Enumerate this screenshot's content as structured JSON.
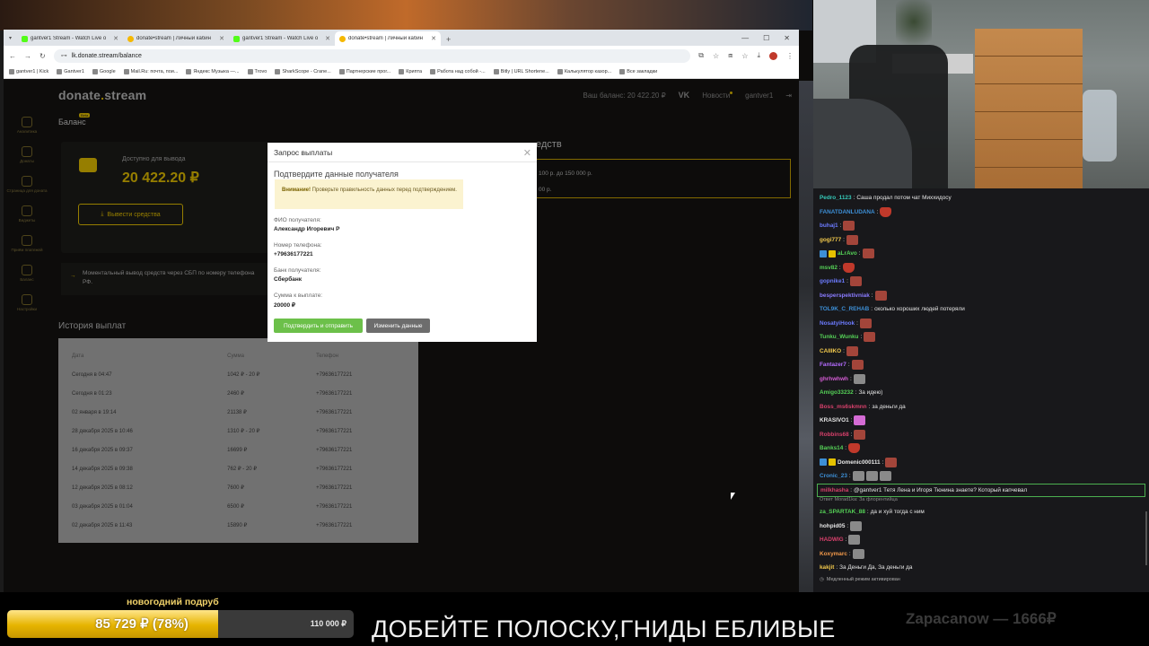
{
  "browser": {
    "tabs": [
      {
        "icon": "kick",
        "label": "gantver1 Stream - Watch Live o",
        "active": false
      },
      {
        "icon": "donate",
        "label": "donate•stream | Личный кабин",
        "active": false
      },
      {
        "icon": "kick",
        "label": "gantver1 Stream - Watch Live o",
        "active": false
      },
      {
        "icon": "donate",
        "label": "donate•stream | Личный кабин",
        "active": true
      }
    ],
    "new_tab": "+",
    "url": "lk.donate.stream/balance",
    "bookmarks": [
      "gantver1 | Kick",
      "Gantver1",
      "Google",
      "Mail.Ru: почта, пои...",
      "Яндекс Музыка —...",
      "Trovo",
      "SharkScope - Crane...",
      "Партнерские прог...",
      "Крипта",
      "Работа над собой -...",
      "Bitly | URL Shortene...",
      "Калькулятор казор...",
      "Все закладки"
    ]
  },
  "site": {
    "logo_main": "donate",
    "logo_dot": ".",
    "logo_end": "stream",
    "balance_header": "Ваш баланс: 20 422.20 ₽",
    "vk": "VK",
    "news": "Новости",
    "user": "gantver1",
    "sidebar": [
      {
        "icon": "analytics-icon",
        "label": "Аналитика"
      },
      {
        "icon": "donations-icon",
        "label": "Донаты"
      },
      {
        "icon": "page-icon",
        "label": "Страница для доната"
      },
      {
        "icon": "widgets-icon",
        "label": "Виджеты"
      },
      {
        "icon": "payments-icon",
        "label": "Приём платежей"
      },
      {
        "icon": "balance-icon",
        "label": "Баланс"
      },
      {
        "icon": "settings-icon",
        "label": "Настройки"
      }
    ],
    "page_title": "Баланс",
    "beta_badge": "Beta",
    "available_label": "Доступно для вывода",
    "available_value": "20 422.20 ₽",
    "withdraw_button": "Вывести средства",
    "sbp_note": "Моментальный вывод средств через СБП по номеру телефона РФ.",
    "conditions_title": "едств",
    "conditions_lines": [
      "100 р. до 150 000 р.",
      "00 р."
    ],
    "history_title": "История выплат",
    "history_columns": [
      "Дата",
      "Сумма",
      "Телефон"
    ],
    "history_rows": [
      [
        "Сегодня в 04:47",
        "1042 ₽ - 20 ₽",
        "+79636177221"
      ],
      [
        "Сегодня в 01:23",
        "2460 ₽",
        "+79636177221"
      ],
      [
        "02 января в 19:14",
        "21138 ₽",
        "+79636177221"
      ],
      [
        "28 декабря 2025 в 10:46",
        "1310 ₽ - 20 ₽",
        "+79636177221"
      ],
      [
        "16 декабря 2025 в 09:37",
        "16699 ₽",
        "+79636177221"
      ],
      [
        "14 декабря 2025 в 09:38",
        "762 ₽ - 20 ₽",
        "+79636177221"
      ],
      [
        "12 декабря 2025 в 08:12",
        "7600 ₽",
        "+79636177221"
      ],
      [
        "03 декабря 2025 в 01:04",
        "6500 ₽",
        "+79636177221"
      ],
      [
        "02 декабря 2025 в 11:43",
        "15890 ₽",
        "+79636177221"
      ]
    ]
  },
  "modal": {
    "title": "Запрос выплаты",
    "subtitle": "Подтвердите данные получателя",
    "warning_bold": "Внимание!",
    "warning_text": " Проверьте правильность данных перед подтверждением.",
    "fields": [
      {
        "label": "ФИО получателя:",
        "value": "Александр Игоревич Р"
      },
      {
        "label": "Номер телефона:",
        "value": "+79636177221"
      },
      {
        "label": "Банк получателя:",
        "value": "Сбербанк"
      },
      {
        "label": "Сумма к выплате:",
        "value": "20000 ₽"
      }
    ],
    "confirm_button": "Подтвердить и отправить",
    "edit_button": "Изменить данные"
  },
  "chat": {
    "messages": [
      {
        "user": "Pedro_1123",
        "color": "#35c9b8",
        "text": "Саша продал потом чат Миххидосу",
        "emotes": 0
      },
      {
        "user": "FANATDANLUDANA",
        "color": "#3d8fd6",
        "text": "",
        "emotes": 1,
        "emote_style": "red"
      },
      {
        "user": "buhaj1",
        "color": "#6c7bff",
        "text": "",
        "emotes": 1
      },
      {
        "user": "gogi777",
        "color": "#f2c94c",
        "text": "",
        "emotes": 1
      },
      {
        "user": "aLrAvo",
        "color": "#55d157",
        "text": "",
        "emotes": 1,
        "badges": 2
      },
      {
        "user": "msv82",
        "color": "#55d157",
        "text": "",
        "emotes": 1,
        "emote_style": "red"
      },
      {
        "user": "gopnike1",
        "color": "#6c7bff",
        "text": "",
        "emotes": 1
      },
      {
        "user": "besperspektivniak",
        "color": "#8a7bff",
        "text": "",
        "emotes": 1
      },
      {
        "user": "TOL9K_C_REHAB",
        "color": "#3d8fd6",
        "text": "сколько хороших людей потеряли",
        "emotes": 0
      },
      {
        "user": "NosatyiHook",
        "color": "#6c7bff",
        "text": "",
        "emotes": 1
      },
      {
        "user": "Tunku_Wunku",
        "color": "#55d157",
        "text": "",
        "emotes": 1
      },
      {
        "user": "CAIIIKO",
        "color": "#f2c94c",
        "text": "",
        "emotes": 1
      },
      {
        "user": "Fantazer7",
        "color": "#b46cff",
        "text": "",
        "emotes": 1
      },
      {
        "user": "ghrhwhwh",
        "color": "#d45cd4",
        "text": "",
        "emotes": 1,
        "emote_style": "gray"
      },
      {
        "user": "Amigo33232",
        "color": "#55d157",
        "text": "За идею)",
        "emotes": 0
      },
      {
        "user": "Boss_ms6skmnn",
        "color": "#d6406b",
        "text": "за деньги да",
        "emotes": 0
      },
      {
        "user": "KRASIVO1",
        "color": "#e6e6e6",
        "text": "",
        "emotes": 1,
        "emote_style": "pink"
      },
      {
        "user": "Robbins68",
        "color": "#d6406b",
        "text": "",
        "emotes": 1
      },
      {
        "user": "Banks14",
        "color": "#55d157",
        "text": "",
        "emotes": 1,
        "emote_style": "red"
      },
      {
        "user": "Domenic000111",
        "color": "#e6e6e6",
        "text": "",
        "emotes": 1,
        "badges": 2
      },
      {
        "user": "Cronic_23",
        "color": "#3d8fd6",
        "text": "",
        "emotes": 3,
        "emote_style": "gray"
      },
      {
        "user": "milkhasha",
        "color": "#d6406b",
        "text": "@gantver1 Тетя Лена и Игоря Тюнина знаете? Который капчевал",
        "emotes": 0,
        "highlight": true
      },
      {
        "user": "za_SPARTAK_88",
        "color": "#55d157",
        "text": "да и хуй тогда с ним",
        "emotes": 0,
        "reply": "Ответ Morad1ka: За флорентийца"
      },
      {
        "user": "hohpid05",
        "color": "#e6e6e6",
        "text": "",
        "emotes": 1,
        "emote_style": "gray"
      },
      {
        "user": "HADWIG",
        "color": "#d6406b",
        "text": "",
        "emotes": 1,
        "emote_style": "gray"
      },
      {
        "user": "Koxymarc",
        "color": "#f2994a",
        "text": "",
        "emotes": 1,
        "emote_style": "gray"
      },
      {
        "user": "kakjit",
        "color": "#f2c94c",
        "text": "За Деньги Да, За деньги да",
        "emotes": 0
      }
    ],
    "slow_mode": "Медленный режим активирован"
  },
  "banner": {
    "goal_label": "новогодний подруб",
    "goal_current": "85 729 ₽ (78%)",
    "goal_target": "110 000 ₽",
    "goal_progress": 0.78,
    "message": "ДОБЕЙТЕ ПОЛОСКУ,ГНИДЫ ЕБЛИВЫЕ",
    "donor": "Zapacanow — 1666₽"
  },
  "colors": {
    "accent": "#e6c200",
    "chat_bg": "#18181b",
    "confirm": "#6cc04a"
  }
}
